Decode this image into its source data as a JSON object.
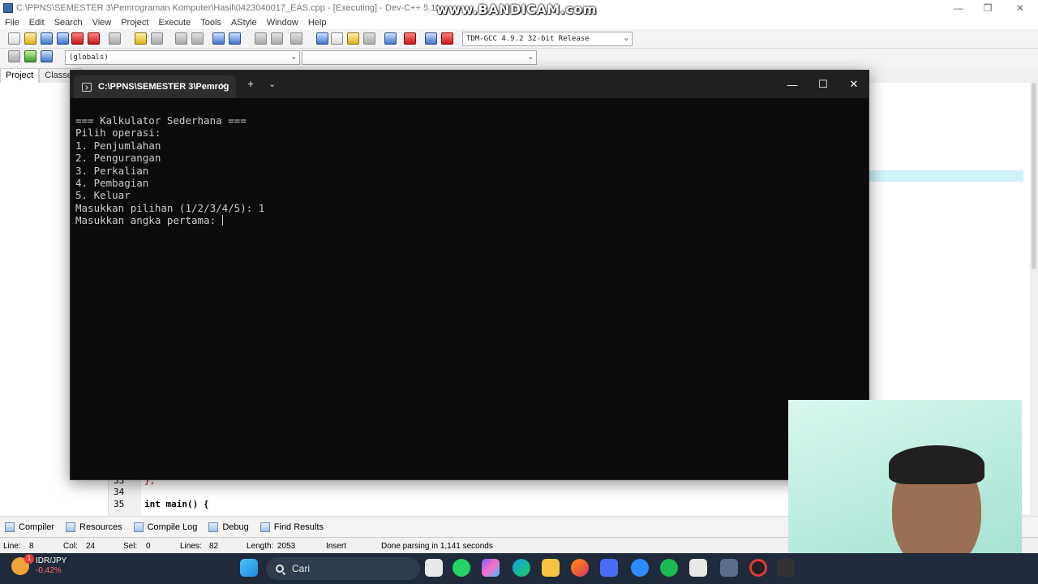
{
  "ide": {
    "title": "C:\\PPNS\\SEMESTER 3\\Pemrograman Komputer\\Hasil\\0423040017_EAS.cpp - [Executing] - Dev-C++ 5.11",
    "menu": [
      "File",
      "Edit",
      "Search",
      "View",
      "Project",
      "Execute",
      "Tools",
      "AStyle",
      "Window",
      "Help"
    ],
    "compiler_select": "TDM-GCC 4.9.2 32-bit Release",
    "scope_select": "(globals)",
    "panel_tabs": [
      "Project",
      "Classes"
    ],
    "code_lines": [
      {
        "num": "33",
        "text": "};"
      },
      {
        "num": "34",
        "text": ""
      },
      {
        "num": "35",
        "text": "int main() {"
      }
    ],
    "bottom_tabs": [
      "Compiler",
      "Resources",
      "Compile Log",
      "Debug",
      "Find Results"
    ],
    "status": {
      "line_label": "Line:",
      "line": "8",
      "col_label": "Col:",
      "col": "24",
      "sel_label": "Sel:",
      "sel": "0",
      "lines_label": "Lines:",
      "lines": "82",
      "length_label": "Length:",
      "length": "2053",
      "mode": "Insert",
      "message": "Done parsing in 1,141 seconds"
    }
  },
  "watermark": "www.BANDICAM.com",
  "terminal": {
    "tab_title": "C:\\PPNS\\SEMESTER 3\\Pemrog",
    "lines": [
      "=== Kalkulator Sederhana ===",
      "Pilih operasi:",
      "1. Penjumlahan",
      "2. Pengurangan",
      "3. Perkalian",
      "4. Pembagian",
      "5. Keluar",
      "Masukkan pilihan (1/2/3/4/5): 1",
      "Masukkan angka pertama: "
    ]
  },
  "taskbar": {
    "ticker_name": "IDR/JPY",
    "ticker_change": "-0,42%",
    "ticker_badge": "1",
    "search_label": "Cari",
    "colors": {
      "background": "#1f2b3a",
      "ticker_down": "#ff6b6b"
    }
  }
}
